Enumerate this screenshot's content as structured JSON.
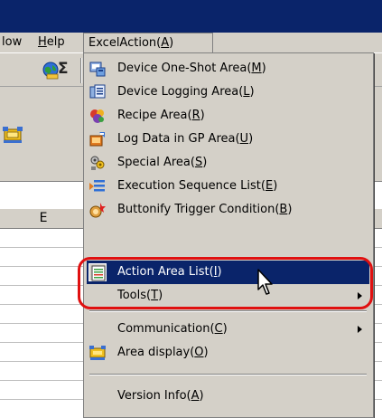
{
  "menubar": {
    "window_partial": "low",
    "help": "Help",
    "excelaction": "ExcelAction(A)"
  },
  "toolbar": {
    "sigma": "Σ"
  },
  "columns": [
    "E",
    ""
  ],
  "dropdown": {
    "items": [
      {
        "label": "Device One-Shot Area(M)",
        "icon": "device-one-shot-icon"
      },
      {
        "label": "Device Logging Area(L)",
        "icon": "device-logging-icon"
      },
      {
        "label": "Recipe Area(R)",
        "icon": "recipe-icon"
      },
      {
        "label": "Log Data in GP Area(U)",
        "icon": "log-data-icon"
      },
      {
        "label": "Special Area(S)",
        "icon": "special-area-icon"
      },
      {
        "label": "Execution Sequence List(E)",
        "icon": "execution-sequence-icon"
      },
      {
        "label": "Buttonify Trigger Condition(B)",
        "icon": "buttonify-trigger-icon"
      },
      {
        "label": "Action Area List(I)",
        "icon": "action-area-list-icon",
        "selected": true
      },
      {
        "label": "Tools(T)",
        "submenu": true
      },
      {
        "label": "Communication(C)",
        "submenu": true
      },
      {
        "label": "Area display(O)",
        "icon": "area-display-icon"
      },
      {
        "label": "Version Info(A)"
      }
    ]
  },
  "colors": {
    "title_bar": "#0a246a",
    "menu_bg": "#d4d0c8",
    "selected_bg": "#0a246a",
    "highlight_ring": "#e01010"
  }
}
